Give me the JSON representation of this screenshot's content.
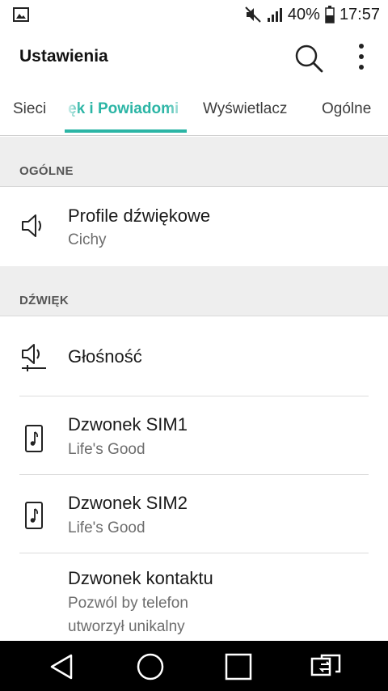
{
  "status_bar": {
    "battery": "40%",
    "time": "17:57",
    "icons": [
      "gallery-icon",
      "mute-icon",
      "signal-icon",
      "battery-icon"
    ]
  },
  "app_bar": {
    "title": "Ustawienia",
    "icons": [
      "search-icon",
      "more-vert-icon"
    ]
  },
  "tabs": [
    {
      "label": "Sieci",
      "active": false
    },
    {
      "label": "Dźwięk i Powiadomienia",
      "visible_label": "ęk i Powiadomi",
      "active": true
    },
    {
      "label": "Wyświetlacz",
      "active": false
    },
    {
      "label": "Ogólne",
      "active": false
    }
  ],
  "sections": {
    "general": {
      "header": "OGÓLNE",
      "items": [
        {
          "title": "Profile dźwiękowe",
          "subtitle": "Cichy",
          "icon": "speaker-icon"
        }
      ]
    },
    "sound": {
      "header": "DŹWIĘK",
      "items": [
        {
          "title": "Głośność",
          "icon": "volume-slider-icon"
        },
        {
          "title": "Dzwonek SIM1",
          "subtitle": "Life's Good",
          "icon": "ringtone-icon"
        },
        {
          "title": "Dzwonek SIM2",
          "subtitle": "Life's Good",
          "icon": "ringtone-icon"
        },
        {
          "title": "Dzwonek kontaktu",
          "subtitle_line1": "Pozwól by telefon",
          "subtitle_line2": "utworzył unikalny"
        }
      ]
    }
  },
  "nav_bar": {
    "icons": [
      "back-icon",
      "home-icon",
      "recents-icon",
      "dual-window-icon"
    ]
  },
  "colors": {
    "accent": "#2bb5a5",
    "section_bg": "#eeeeee",
    "nav_bg": "#000000"
  }
}
